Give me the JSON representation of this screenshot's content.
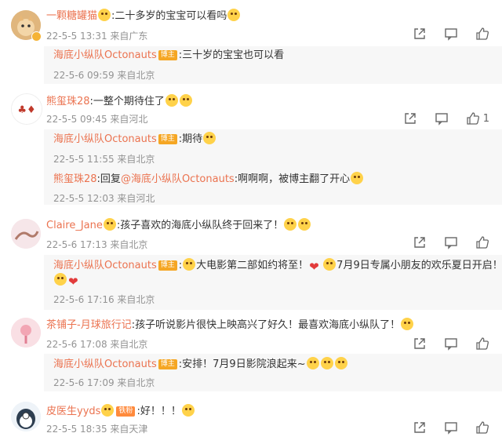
{
  "comments": [
    {
      "user": "一颗糖罐猫",
      "text": ":二十多岁的宝宝可以看吗",
      "time": "22-5-5 13:31 来自广东",
      "reply": {
        "user": "海底小纵队Octonauts",
        "tag": "博主",
        "text": ":三十岁的宝宝也可以看",
        "time": "22-5-6 09:59 来自北京"
      }
    },
    {
      "user": "熊玺珠28",
      "text": ":一整个期待住了",
      "time": "22-5-5 09:45 来自河北",
      "likes": "1",
      "reply": {
        "user": "海底小纵队Octonauts",
        "tag": "博主",
        "text": ":期待",
        "time": "22-5-5 11:55 来自北京"
      },
      "reply2": {
        "user": "熊玺珠28",
        "text_a": ":回复",
        "mention": "@海底小纵队Octonauts",
        "text_b": ":啊啊啊，被博主翻了开心",
        "time": "22-5-5 12:03 来自河北"
      }
    },
    {
      "user": "Claire_Jane",
      "text": ":孩子喜欢的海底小纵队终于回来了！",
      "time": "22-5-6 17:13 来自北京",
      "reply": {
        "user": "海底小纵队Octonauts",
        "tag": "博主",
        "text_a": ":",
        "text_b": "大电影第二部如约将至！",
        "text_c": "7月9日专属小朋友的欢乐夏日开启！",
        "time": "22-5-6 17:16 来自北京"
      }
    },
    {
      "user": "茶铺子-月球旅行记",
      "text": ":孩子听说影片很快上映高兴了好久！最喜欢海底小纵队了！",
      "time": "22-5-6 17:08 来自北京",
      "reply": {
        "user": "海底小纵队Octonauts",
        "tag": "博主",
        "text": ":安排！7月9日影院浪起来~",
        "time": "22-5-6 17:09 来自北京"
      }
    },
    {
      "user": "皮医生yyds",
      "tag": "铁粉",
      "text": ":好！！！",
      "time": "22-5-5 18:35 来自天津"
    }
  ],
  "icons": [
    "share-icon",
    "comment-icon",
    "like-icon"
  ],
  "colors": {
    "username": "#eb7350",
    "meta": "#939393",
    "reply_bg": "#f7f7f7"
  }
}
